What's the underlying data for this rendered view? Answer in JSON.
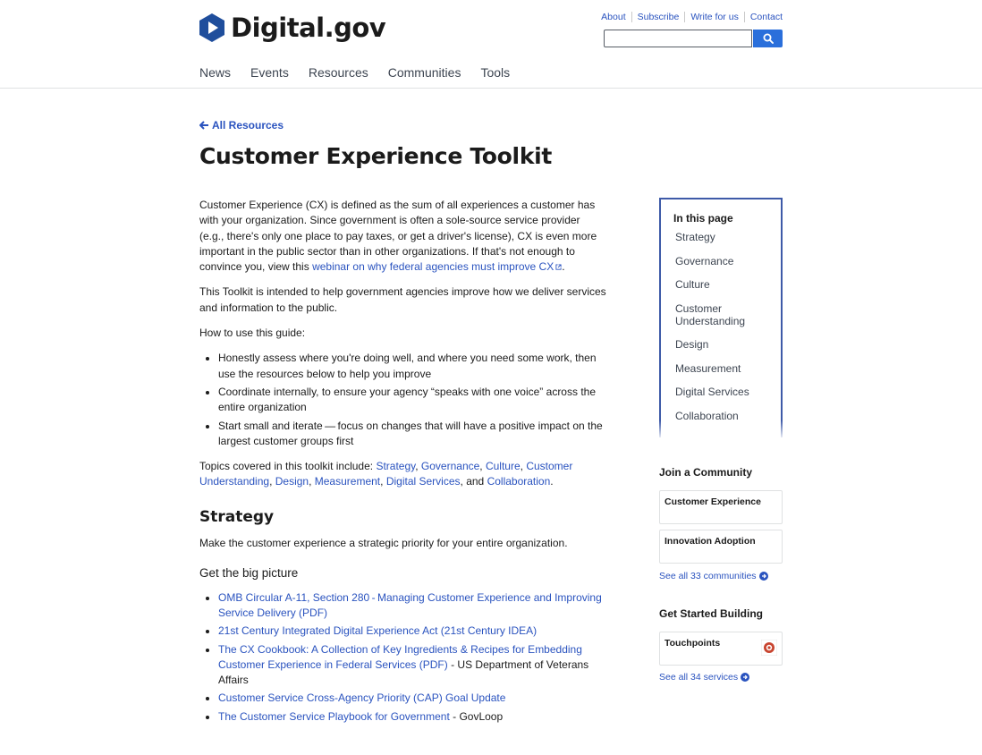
{
  "site": {
    "logo_text": "Digital.gov"
  },
  "top_links": [
    "About",
    "Subscribe",
    "Write for us",
    "Contact"
  ],
  "search": {
    "placeholder": "",
    "button_icon": "search-icon"
  },
  "nav": [
    "News",
    "Events",
    "Resources",
    "Communities",
    "Tools"
  ],
  "back_link": "All Resources",
  "page_title": "Customer Experience Toolkit",
  "intro": {
    "p1_text": "Customer Experience (CX) is defined as the sum of all experiences a customer has with your organization. Since government is often a sole-source service provider (e.g., there's only one place to pay taxes, or get a driver's license), CX is even more important in the public sector than in other organizations. If that's not enough to convince you, view this ",
    "p1_link": "webinar on why federal agencies must improve CX",
    "p1_end": ".",
    "p2": "This Toolkit is intended to help government agencies improve how we deliver services and information to the public.",
    "p3": "How to use this guide:",
    "bullets": [
      "Honestly assess where you're doing well, and where you need some work, then use the resources below to help you improve",
      "Coordinate internally, to ensure your agency “speaks with one voice” across the entire organization",
      "Start small and iterate — focus on changes that will have a positive impact on the largest customer groups first"
    ],
    "topics_prefix": "Topics covered in this toolkit include: ",
    "topics": [
      "Strategy",
      "Governance",
      "Culture",
      "Customer Understanding",
      "Design",
      "Measurement",
      "Digital Services",
      "Collaboration"
    ],
    "topics_and": "and",
    "topics_end": "."
  },
  "strategy": {
    "heading": "Strategy",
    "desc": "Make the customer experience a strategic priority for your entire organization.",
    "sub": "Get the big picture",
    "links": [
      {
        "link": "OMB Circular A-11, Section 280 - Managing Customer Experience and Improving Service Delivery (PDF)",
        "suffix": ""
      },
      {
        "link": "21st Century Integrated Digital Experience Act (21st Century IDEA)",
        "suffix": ""
      },
      {
        "link": "The CX Cookbook: A Collection of Key Ingredients & Recipes for Embedding Customer Experience in Federal Services (PDF)",
        "suffix": " - US Department of Veterans Affairs"
      },
      {
        "link": "Customer Service Cross-Agency Priority (CAP) Goal Update",
        "suffix": ""
      },
      {
        "link": "The Customer Service Playbook for Government",
        "suffix": " - GovLoop"
      }
    ]
  },
  "toc": {
    "title": "In this page",
    "items": [
      "Strategy",
      "Governance",
      "Culture",
      "Customer Understanding",
      "Design",
      "Measurement",
      "Digital Services",
      "Collaboration"
    ]
  },
  "community": {
    "heading": "Join a Community",
    "cards": [
      "Customer Experience",
      "Innovation Adoption"
    ],
    "see_all": "See all 33 communities"
  },
  "building": {
    "heading": "Get Started Building",
    "card": "Touchpoints",
    "see_all": "See all 34 services"
  },
  "colors": {
    "link": "#2a53bf",
    "accent": "#3e5aa8",
    "search_button": "#2a6fdb",
    "text": "#1b1b1b"
  }
}
